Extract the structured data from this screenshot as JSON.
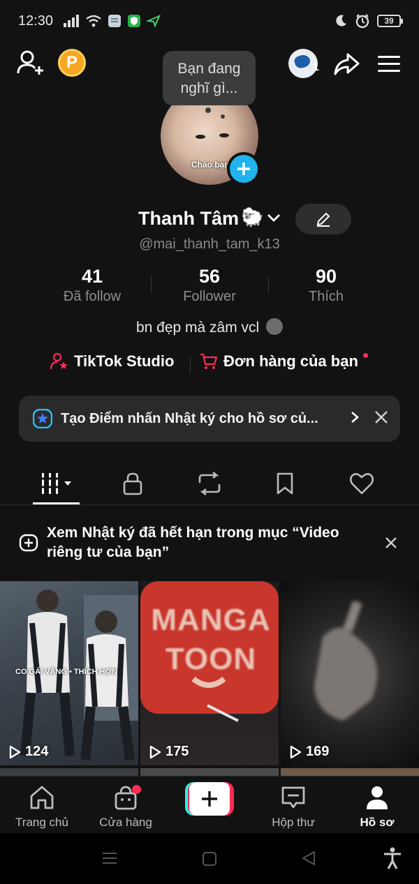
{
  "status_bar": {
    "time": "12:30",
    "battery": "39"
  },
  "top_bar": {
    "coin_label": "P",
    "account_count": "1"
  },
  "profile": {
    "thought_bubble": "Bạn đang nghĩ gì...",
    "avatar_caption": "Chào bạn",
    "display_name": "Thanh Tâm",
    "name_emoji": "🐑",
    "handle": "@mai_thanh_tam_k13",
    "stats": [
      {
        "value": "41",
        "label": "Đã follow"
      },
      {
        "value": "56",
        "label": "Follower"
      },
      {
        "value": "90",
        "label": "Thích"
      }
    ],
    "bio": "bn đẹp mà zâm vcl"
  },
  "links": {
    "studio": "TikTok Studio",
    "orders": "Đơn hàng của bạn"
  },
  "banner": {
    "text": "Tạo Điểm nhấn Nhật ký cho hồ sơ củ..."
  },
  "tabs": [
    {
      "name": "videos",
      "icon": "grid-icon"
    },
    {
      "name": "private",
      "icon": "lock-icon"
    },
    {
      "name": "reposts",
      "icon": "repost-icon"
    },
    {
      "name": "favorites",
      "icon": "bookmark-icon"
    },
    {
      "name": "liked",
      "icon": "heart-icon"
    }
  ],
  "notice": {
    "text": "Xem Nhật ký đã hết hạn trong mục “Video riêng tư của bạn”"
  },
  "videos": [
    {
      "views": "124",
      "overlay_text": "CO GÁI VÀNG • THÍCH HƠN"
    },
    {
      "views": "175",
      "overlay_text": "MANGA TOON"
    },
    {
      "views": "169"
    }
  ],
  "bottom_nav": [
    {
      "label": "Trang chủ"
    },
    {
      "label": "Cửa hàng"
    },
    {
      "label": "Hộp thư"
    },
    {
      "label": "Hồ sơ"
    }
  ],
  "colors": {
    "background": "#121212",
    "accent_red": "#fe2c55",
    "accent_cyan": "#25f4ee",
    "add_blue": "#20b3ee"
  }
}
